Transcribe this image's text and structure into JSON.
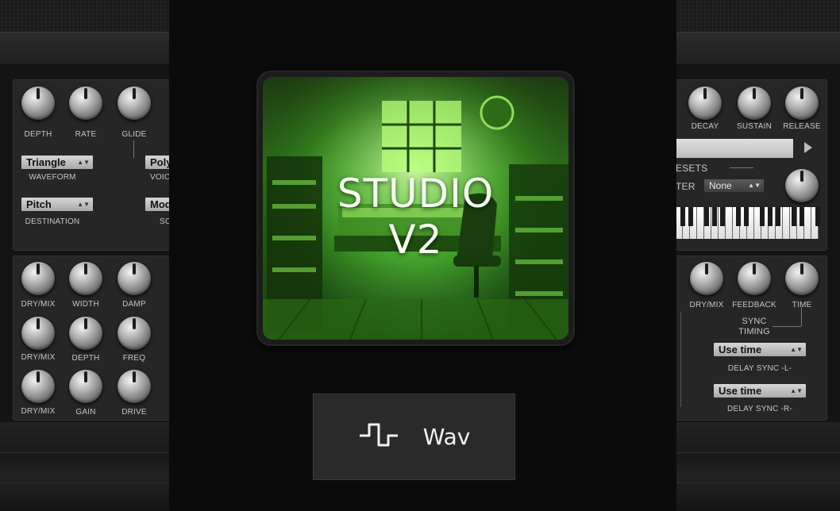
{
  "left_top": {
    "knobs": [
      "DEPTH",
      "RATE",
      "GLIDE"
    ],
    "waveform": {
      "value": "Triangle",
      "label": "WAVEFORM"
    },
    "destination": {
      "value": "Pitch",
      "label": "DESTINATION"
    },
    "voice": {
      "value": "Poly",
      "label": "VOIC"
    },
    "source": {
      "value": "Mod",
      "label": "SC"
    }
  },
  "left_bottom": {
    "row1": [
      "DRY/MIX",
      "WIDTH",
      "DAMP"
    ],
    "row2": [
      "DRY/MIX",
      "DEPTH",
      "FREQ"
    ],
    "row3": [
      "DRY/MIX",
      "GAIN",
      "DRIVE"
    ]
  },
  "right_top": {
    "knobs": [
      "DECAY",
      "SUSTAIN",
      "RELEASE"
    ],
    "presets_label": "ESETS",
    "filter_label": "TER",
    "filter_value": "None"
  },
  "right_bottom": {
    "knobs": [
      "DRY/MIX",
      "FEEDBACK",
      "TIME"
    ],
    "sync_timing": [
      "SYNC",
      "TIMING"
    ],
    "delay_l": {
      "value": "Use time",
      "label": "DELAY SYNC -L-"
    },
    "delay_r": {
      "value": "Use time",
      "label": "DELAY SYNC -R-"
    }
  },
  "cover": {
    "title_line1": "STUDIO",
    "title_line2": "V2"
  },
  "format_button": {
    "label": "Wav",
    "icon": "square-wave-icon"
  }
}
